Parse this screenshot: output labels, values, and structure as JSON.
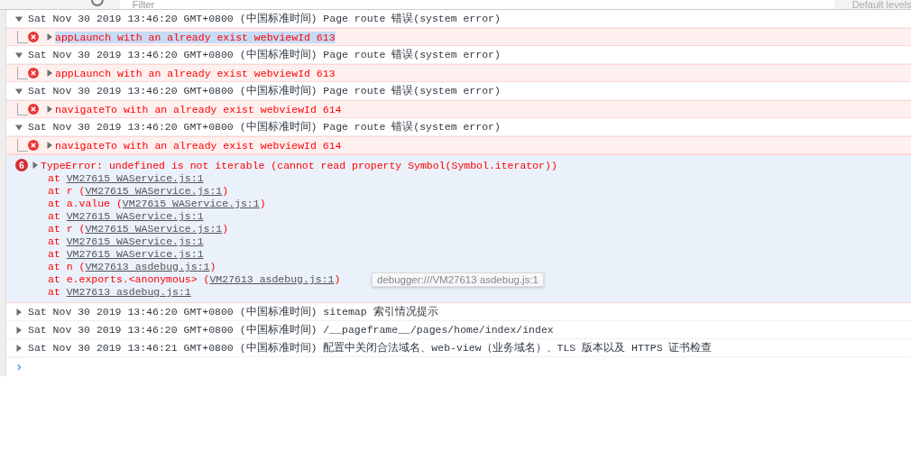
{
  "toolbar": {
    "filter_placeholder": "Filter",
    "levels_dropdown": "Default levels"
  },
  "messages": [
    {
      "kind": "group",
      "expanded": true,
      "text": "Sat Nov 30 2019 13:46:20 GMT+0800 (中国标准时间) Page route 错误(system error)",
      "children": [
        {
          "kind": "error",
          "text": "appLaunch with an already exist webviewId 613",
          "selected": true
        }
      ]
    },
    {
      "kind": "group",
      "expanded": true,
      "text": "Sat Nov 30 2019 13:46:20 GMT+0800 (中国标准时间) Page route 错误(system error)",
      "children": [
        {
          "kind": "error",
          "text": "appLaunch with an already exist webviewId 613",
          "selected": false
        }
      ]
    },
    {
      "kind": "group",
      "expanded": true,
      "text": "Sat Nov 30 2019 13:46:20 GMT+0800 (中国标准时间) Page route 错误(system error)",
      "children": [
        {
          "kind": "error",
          "text": "navigateTo with an already exist webviewId 614",
          "selected": false
        }
      ]
    },
    {
      "kind": "group",
      "expanded": true,
      "text": "Sat Nov 30 2019 13:46:20 GMT+0800 (中国标准时间) Page route 错误(system error)",
      "children": [
        {
          "kind": "error",
          "text": "navigateTo with an already exist webviewId 614",
          "selected": false
        }
      ]
    },
    {
      "kind": "stack",
      "count": "6",
      "expanded": false,
      "text": "TypeError: undefined is not iterable (cannot read property Symbol(Symbol.iterator))",
      "frames": [
        {
          "caller": "at ",
          "link": "VM27615 WAService.js:1"
        },
        {
          "caller": "at r (",
          "link": "VM27615 WAService.js:1",
          "close": ")"
        },
        {
          "caller": "at a.value (",
          "link": "VM27615 WAService.js:1",
          "close": ")"
        },
        {
          "caller": "at ",
          "link": "VM27615 WAService.js:1"
        },
        {
          "caller": "at r (",
          "link": "VM27615 WAService.js:1",
          "close": ")"
        },
        {
          "caller": "at ",
          "link": "VM27615 WAService.js:1"
        },
        {
          "caller": "at ",
          "link": "VM27615 WAService.js:1"
        },
        {
          "caller": "at n (",
          "link": "VM27613 asdebug.js:1",
          "close": ")"
        },
        {
          "caller": "at e.exports.<anonymous> (",
          "link": "VM27613 asdebug.js:1",
          "close": ")"
        },
        {
          "caller": "at ",
          "link": "VM27613 asdebug.js:1"
        }
      ],
      "tooltip": "debugger:///VM27613 asdebug.js:1"
    },
    {
      "kind": "group",
      "expanded": false,
      "text": "Sat Nov 30 2019 13:46:20 GMT+0800 (中国标准时间) sitemap 索引情况提示"
    },
    {
      "kind": "group",
      "expanded": false,
      "text": "Sat Nov 30 2019 13:46:20 GMT+0800 (中国标准时间) /__pageframe__/pages/home/index/index"
    },
    {
      "kind": "group",
      "expanded": false,
      "text": "Sat Nov 30 2019 13:46:21 GMT+0800 (中国标准时间) 配置中关闭合法域名、web-view（业务域名）、TLS 版本以及 HTTPS 证书检查"
    }
  ],
  "prompt": "›"
}
